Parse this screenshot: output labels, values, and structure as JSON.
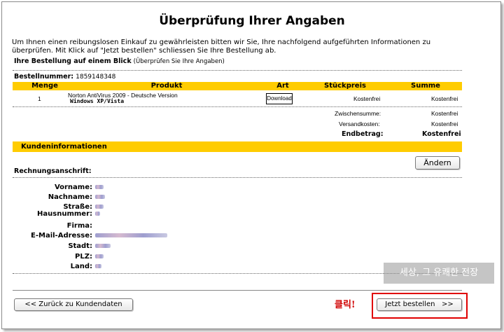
{
  "page": {
    "title": "Überprüfung Ihrer Angaben",
    "intro": "Um Ihnen einen reibungslosen Einkauf zu gewährleisten bitten wir Sie, Ihre nachfolgend aufgeführten Informationen zu überprüfen. Mit Klick auf \"Jetzt bestellen\" schliessen Sie Ihre Bestellung ab."
  },
  "overview": {
    "heading": "Ihre Bestellung auf einem Blick",
    "subheading": "(Überprüfen Sie Ihre Angaben)"
  },
  "order": {
    "number_label": "Bestellnummer:",
    "number_value": "1859148348",
    "columns": [
      "Menge",
      "Produkt",
      "Art",
      "Stückpreis",
      "Summe"
    ],
    "row": {
      "qty": "1",
      "product": "Norton AntiVirus 2009 - Deutsche Version",
      "platform": "Windows XP/Vista",
      "type_button": "Download",
      "unit_price": "Kostenfrei",
      "sum": "Kostenfrei"
    },
    "subtotal_label": "Zwischensumme:",
    "subtotal_value": "Kostenfrei",
    "shipping_label": "Versandkosten:",
    "shipping_value": "Kostenfrei",
    "total_label": "Endbetrag:",
    "total_value": "Kostenfrei"
  },
  "customer": {
    "section_title": "Kundeninformationen",
    "edit_button": "Ändern",
    "billing_heading": "Rechnungsanschrift:",
    "fields": [
      {
        "label": "Vorname:"
      },
      {
        "label": "Nachname:"
      },
      {
        "label": "Straße:"
      },
      {
        "label": "Hausnummer:"
      },
      {
        "label": "Firma:"
      },
      {
        "label": "E-Mail-Adresse:"
      },
      {
        "label": "Stadt:"
      },
      {
        "label": "PLZ:"
      },
      {
        "label": "Land:"
      }
    ]
  },
  "footer": {
    "back_button": "<< Zurück zu Kundendaten",
    "submit_button": "Jetzt bestellen   >>",
    "annotation": "클릭!",
    "watermark": "세상, 그 유쾌한 전장"
  },
  "colors": {
    "accent": "#ffcc00",
    "highlight": "#e00000"
  }
}
